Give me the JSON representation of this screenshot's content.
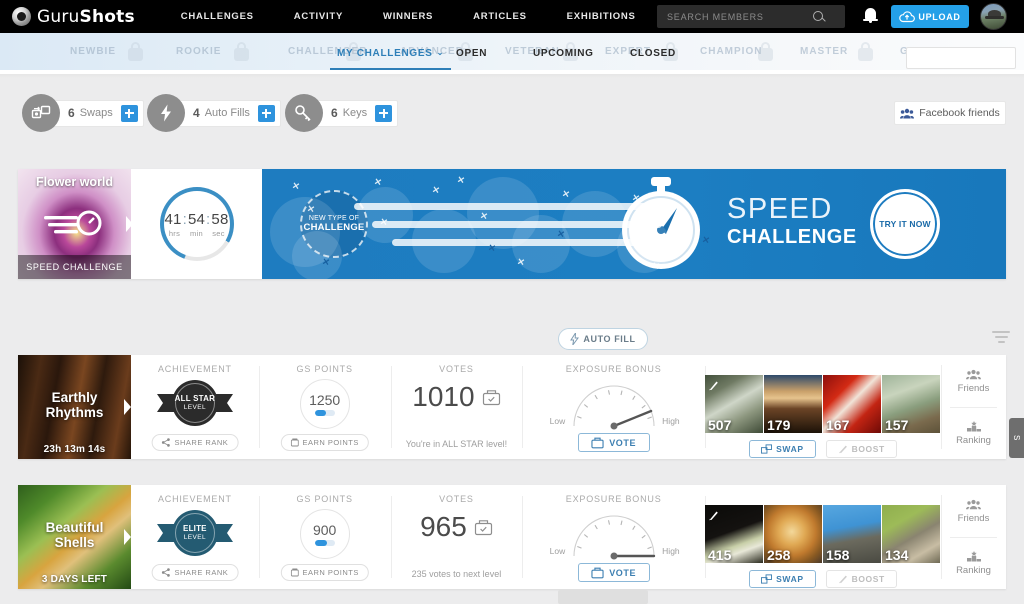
{
  "header": {
    "logo_text_light": "Guru",
    "logo_text_bold": "Shots",
    "nav": [
      {
        "label": "CHALLENGES"
      },
      {
        "label": "ACTIVITY"
      },
      {
        "label": "WINNERS"
      },
      {
        "label": "ARTICLES"
      },
      {
        "label": "EXHIBITIONS"
      }
    ],
    "search_placeholder": "SEARCH MEMBERS",
    "search_value": "",
    "upload_label": "UPLOAD"
  },
  "subnav": {
    "ghost_levels": [
      "NEWBIE",
      "ROOKIE",
      "CHALLENGER",
      "ADVANCED",
      "VETERAN",
      "EXPERT",
      "CHAMPION",
      "MASTER",
      "GURU"
    ],
    "tabs": [
      {
        "label": "MY CHALLENGES",
        "active": true,
        "caret": "⌄"
      },
      {
        "label": "OPEN",
        "active": false
      },
      {
        "label": "UPCOMING",
        "active": false
      },
      {
        "label": "CLOSED",
        "active": false
      }
    ]
  },
  "resources": [
    {
      "count": "6",
      "label": "Swaps",
      "icon": "swap-icon"
    },
    {
      "count": "4",
      "label": "Auto Fills",
      "icon": "bolt-icon"
    },
    {
      "count": "6",
      "label": "Keys",
      "icon": "key-icon"
    }
  ],
  "facebook_friends_label": "Facebook friends",
  "banner": {
    "thumb_title": "Flower world",
    "thumb_footer": "SPEED CHALLENGE",
    "timer": {
      "hours": "41",
      "minutes": "54",
      "seconds": "58",
      "unit_h": "hrs",
      "unit_m": "min",
      "unit_s": "sec"
    },
    "badge_line1": "NEW TYPE OF",
    "badge_line2": "CHALLENGE",
    "title_line1": "SPEED",
    "title_line2": "CHALLENGE",
    "cta_label": "TRY IT NOW"
  },
  "autofill_label": "AUTO FILL",
  "columns": {
    "achievement": "ACHIEVEMENT",
    "gs_points": "GS POINTS",
    "votes": "VOTES",
    "exposure_bonus": "EXPOSURE BONUS"
  },
  "common": {
    "share_rank": "SHARE RANK",
    "earn_points": "EARN POINTS",
    "vote": "VOTE",
    "swap": "SWAP",
    "boost": "BOOST",
    "friends": "Friends",
    "ranking": "Ranking",
    "gauge_low": "Low",
    "gauge_high": "High"
  },
  "challenges": [
    {
      "title_line1": "Earthly",
      "title_line2": "Rhythms",
      "time_left": "23h 13m 14s",
      "badge_l1": "ALL STAR",
      "badge_l2": "LEVEL",
      "badge_color": "#2b2b2b",
      "gs_points": "1250",
      "gs_progress_pct": 55,
      "votes": "1010",
      "votes_sub": "You're in ALL STAR level!",
      "gauge_angle": -22,
      "photos": [
        {
          "votes": "507",
          "boosted": true
        },
        {
          "votes": "179",
          "boosted": false
        },
        {
          "votes": "167",
          "boosted": false
        },
        {
          "votes": "157",
          "boosted": false
        }
      ]
    },
    {
      "title_line1": "Beautiful",
      "title_line2": "Shells",
      "time_left": "3 DAYS LEFT",
      "badge_l1": "ELITE",
      "badge_l2": "LEVEL",
      "badge_color": "#245b72",
      "gs_points": "900",
      "gs_progress_pct": 60,
      "votes": "965",
      "votes_sub": "235 votes to next level",
      "gauge_angle": 0,
      "photos": [
        {
          "votes": "415",
          "boosted": true
        },
        {
          "votes": "258",
          "boosted": false
        },
        {
          "votes": "158",
          "boosted": false
        },
        {
          "votes": "134",
          "boosted": false
        }
      ]
    }
  ],
  "edge_tab_label": "S",
  "colors": {
    "accent_blue": "#2e93dd",
    "banner_blue": "#1e7cc0",
    "link_blue": "#3c7fb1"
  }
}
